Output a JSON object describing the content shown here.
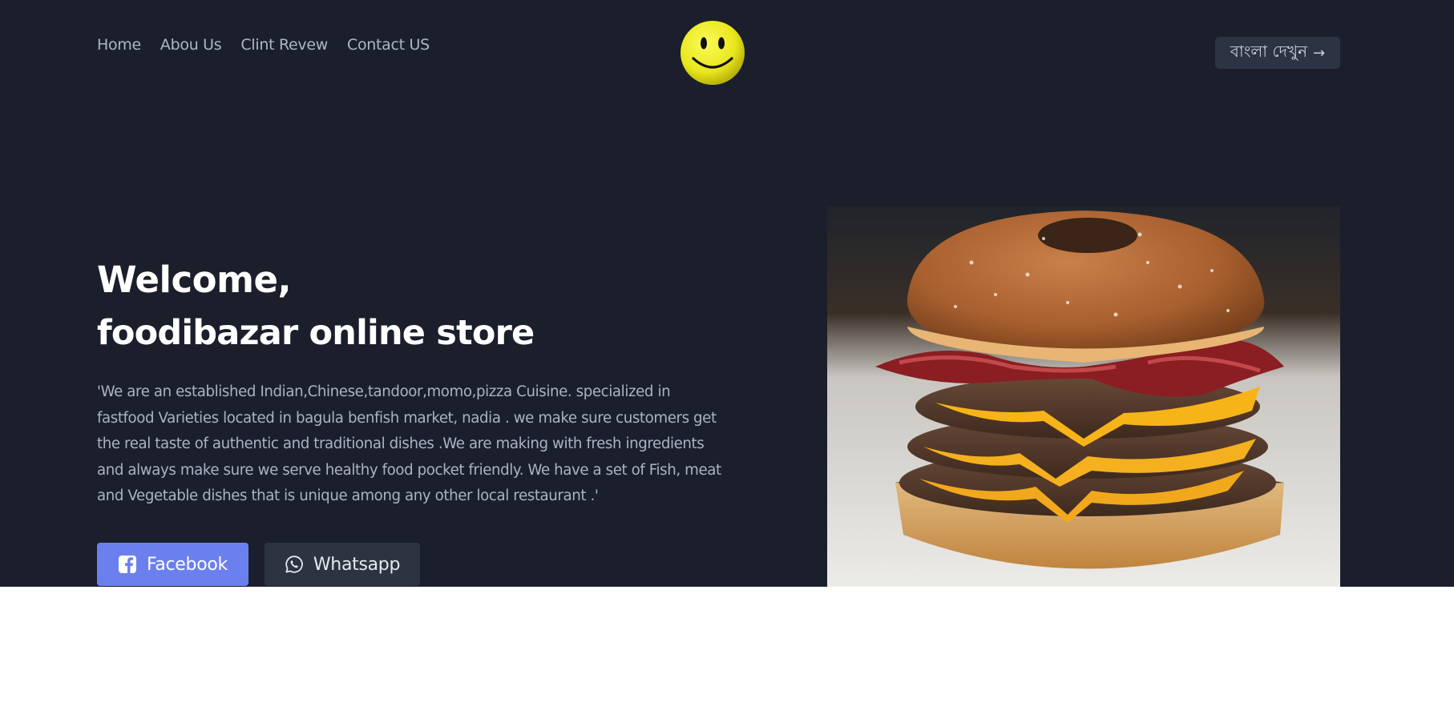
{
  "nav": {
    "items": [
      {
        "label": "Home"
      },
      {
        "label": "Abou Us"
      },
      {
        "label": "Clint Revew"
      },
      {
        "label": "Contact US"
      }
    ]
  },
  "logo": {
    "icon": "smiley-face-icon"
  },
  "language_button": {
    "label": "বাংলা দেখুন",
    "arrow": "→"
  },
  "hero": {
    "welcome": "Welcome,",
    "store_name": "foodibazar online store",
    "description": "'We are an established Indian,Chinese,tandoor,momo,pizza Cuisine. specialized in fastfood Varieties located in bagula benfish market, nadia . we make sure customers get the real taste of authentic and traditional dishes .We are making with fresh ingredients and always make sure we serve healthy food pocket friendly. We have a set of Fish, meat and Vegetable dishes that is unique among any other local restaurant .'",
    "image": "burger-photo"
  },
  "buttons": {
    "facebook": {
      "label": "Facebook",
      "icon": "facebook-icon"
    },
    "whatsapp": {
      "label": "Whatsapp",
      "icon": "whatsapp-icon"
    }
  },
  "colors": {
    "background": "#1b1f2b",
    "facebook_button": "#6b80ee",
    "secondary_button": "#2c3341"
  }
}
